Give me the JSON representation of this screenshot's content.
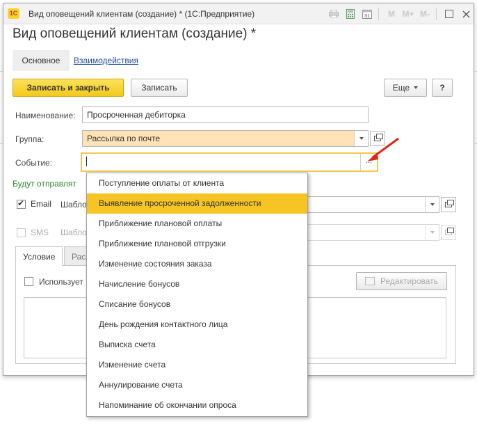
{
  "window": {
    "title": "Вид оповещений клиентам (создание) * (1С:Предприятие)",
    "logo_text": "1С",
    "toolbar_icons": [
      "print-icon",
      "calculator-icon",
      "calendar-icon",
      "memory-m-icon",
      "memory-mplus-icon",
      "memory-mminus-icon",
      "minimize-icon",
      "close-icon"
    ],
    "m_labels": {
      "m": "M",
      "mplus": "M+",
      "mminus": "M-"
    },
    "calendar_day": "31"
  },
  "form": {
    "title": "Вид оповещений клиентам (создание) *",
    "tabs": [
      {
        "label": "Основное",
        "active": true
      },
      {
        "label": "Взаимодействия",
        "active": false
      }
    ]
  },
  "toolbar": {
    "save_close_label": "Записать и закрыть",
    "save_label": "Записать",
    "more_label": "Еще",
    "help_label": "?"
  },
  "fields": {
    "name_label": "Наименование:",
    "name_value": "Просроченная дебиторка",
    "group_label": "Группа:",
    "group_value": "Рассылка по почте",
    "event_label": "Событие:",
    "event_value": "",
    "event_choice_button": "..."
  },
  "send_section": {
    "heading": "Будут отправлят",
    "email_label": "Email",
    "email_template_label": "Шабло",
    "email_checked": true,
    "sms_label": "SMS",
    "sms_template_label": "Шабло",
    "sms_checked": false
  },
  "bottom_tabs": [
    {
      "label": "Условие",
      "active": true
    },
    {
      "label": "Рас",
      "active": false
    }
  ],
  "condition": {
    "use_label": "Использует",
    "edit_button_label": "Редактировать"
  },
  "dropdown": {
    "items": [
      "Поступление оплаты от клиента",
      "Выявление просроченной задолженности",
      "Приближение плановой оплаты",
      "Приближение плановой отгрузки",
      "Изменение состояния заказа",
      "Начисление бонусов",
      "Списание бонусов",
      "День рождения контактного лица",
      "Выписка счета",
      "Изменение счета",
      "Аннулирование счета",
      "Напоминание об окончании опроса"
    ],
    "selected_index": 1
  },
  "colors": {
    "accent": "#f3c91b",
    "selected_item": "#f6c524",
    "group_field_bg": "#fde3b6",
    "link": "#1f4e9b",
    "green_text": "#2e8b2e",
    "arrow": "#e0261b"
  }
}
